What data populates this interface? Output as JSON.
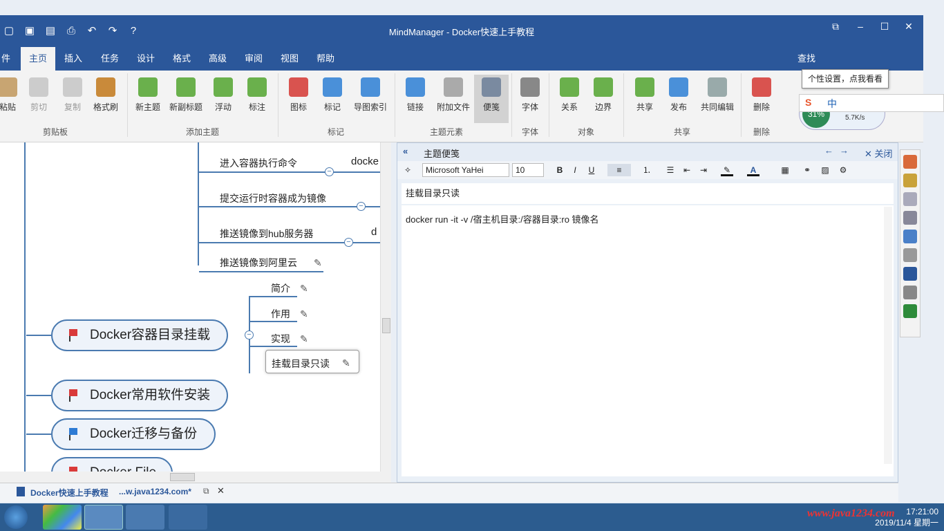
{
  "window": {
    "title": "MindManager - Docker快速上手教程",
    "controls": {
      "restore": "⧉",
      "minimize": "–",
      "maximize": "☐",
      "close": "✕"
    }
  },
  "tabs": [
    {
      "label": "件"
    },
    {
      "label": "主页",
      "active": true
    },
    {
      "label": "插入"
    },
    {
      "label": "任务"
    },
    {
      "label": "设计"
    },
    {
      "label": "格式"
    },
    {
      "label": "高级"
    },
    {
      "label": "审阅"
    },
    {
      "label": "视图"
    },
    {
      "label": "帮助"
    }
  ],
  "find_label": "查找",
  "ribbon": {
    "clipboard": {
      "paste": "粘贴",
      "cut": "剪切",
      "copy": "复制",
      "format_brush": "格式刷",
      "group": "剪贴板"
    },
    "add_topic": {
      "new_topic": "新主题",
      "new_subtopic": "新副标题",
      "floating": "浮动",
      "callout": "标注",
      "group": "添加主题"
    },
    "markers": {
      "icon": "图标",
      "tag": "标记",
      "map_index": "导图索引",
      "group": "标记"
    },
    "topic_elements": {
      "link": "链接",
      "attach": "附加文件",
      "notes": "便笺",
      "group": "主题元素"
    },
    "font": {
      "font": "字体",
      "group": "字体"
    },
    "objects": {
      "relation": "关系",
      "boundary": "边界",
      "group": "对象"
    },
    "share": {
      "share": "共享",
      "publish": "发布",
      "coedit": "共同编辑",
      "group": "共享"
    },
    "delete": {
      "delete": "删除",
      "group": "删除"
    }
  },
  "tooltip": "个性设置，点我看看",
  "ime": {
    "mode": "中",
    "percent": "31%",
    "speed": "5.7K/s"
  },
  "map": {
    "subtopics_top": [
      {
        "label": "进入容器执行命令",
        "trail": "docke"
      },
      {
        "label": "提交运行时容器成为镜像",
        "trail": ""
      },
      {
        "label": "推送镜像到hub服务器",
        "trail": "d"
      },
      {
        "label": "推送镜像到阿里云",
        "trail": ""
      }
    ],
    "branch_children": [
      {
        "label": "简介"
      },
      {
        "label": "作用"
      },
      {
        "label": "实现"
      },
      {
        "label": "挂载目录只读"
      }
    ],
    "main_topics": [
      {
        "label": "Docker容器目录挂载",
        "flag": "#d93a3a"
      },
      {
        "label": "Docker常用软件安装",
        "flag": "#d93a3a"
      },
      {
        "label": "Docker迁移与备份",
        "flag": "#2e7bd4"
      },
      {
        "label": "Docker File",
        "flag": "#d93a3a"
      }
    ]
  },
  "notes": {
    "header": "主题便笺",
    "close": "关闭",
    "font_name": "Microsoft YaHei",
    "font_size": "10",
    "title": "挂载目录只读",
    "body": "docker run -it -v  /宿主机目录:/容器目录:ro 镜像名"
  },
  "doc_tab": {
    "name": "Docker快速上手教程",
    "path": "...w.java1234.com*"
  },
  "taskbar": {
    "watermark": "www.java1234.com",
    "time": "17:21:00",
    "date": "2019/11/4 星期一"
  },
  "colors": {
    "brand": "#2b579a",
    "branch": "#4a7ab0",
    "taskbar": "#2c5c8f"
  }
}
